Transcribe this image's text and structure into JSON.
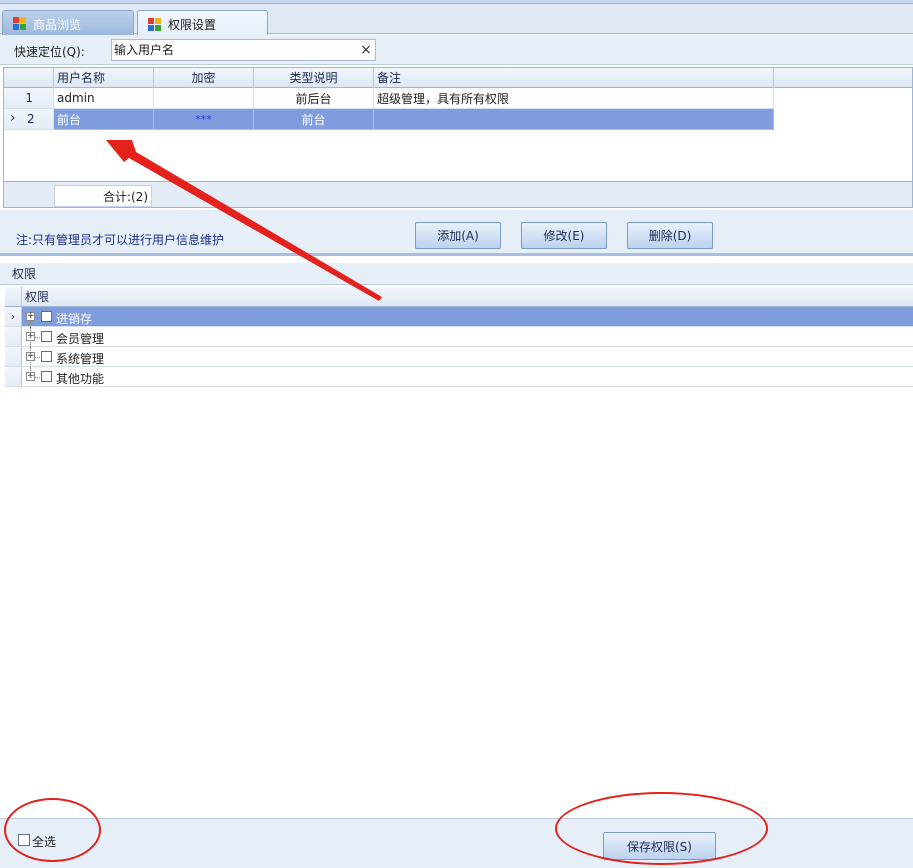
{
  "tabs": [
    {
      "label": "商品浏览",
      "active": false
    },
    {
      "label": "权限设置",
      "active": true
    }
  ],
  "search": {
    "label": "快速定位(Q):",
    "value": "",
    "placeholder": "输入用户名",
    "clear": "×"
  },
  "user_grid": {
    "columns": [
      "用户名称",
      "加密",
      "类型说明",
      "备注"
    ],
    "rows": [
      {
        "index": "1",
        "name": "admin",
        "encrypted": "",
        "type": "前后台",
        "note": "超级管理，具有所有权限",
        "selected": false
      },
      {
        "index": "2",
        "name": "前台",
        "encrypted": "***",
        "type": "前台",
        "note": "",
        "selected": true
      }
    ],
    "row_marker": "›",
    "total": "合计:(2)"
  },
  "note": "注:只有管理员才可以进行用户信息维护",
  "buttons": {
    "add": "添加(A)",
    "edit": "修改(E)",
    "delete": "删除(D)",
    "save": "保存权限(S)"
  },
  "permissions": {
    "section_title": "权限",
    "column_header": "权限",
    "items": [
      {
        "label": "进销存",
        "selected": true
      },
      {
        "label": "会员管理",
        "selected": false
      },
      {
        "label": "系统管理",
        "selected": false
      },
      {
        "label": "其他功能",
        "selected": false
      }
    ]
  },
  "select_all": "全选",
  "colors": {
    "selection": "#7f9ddc",
    "annotation": "#e5211b",
    "note_text": "#1e2f8a"
  }
}
